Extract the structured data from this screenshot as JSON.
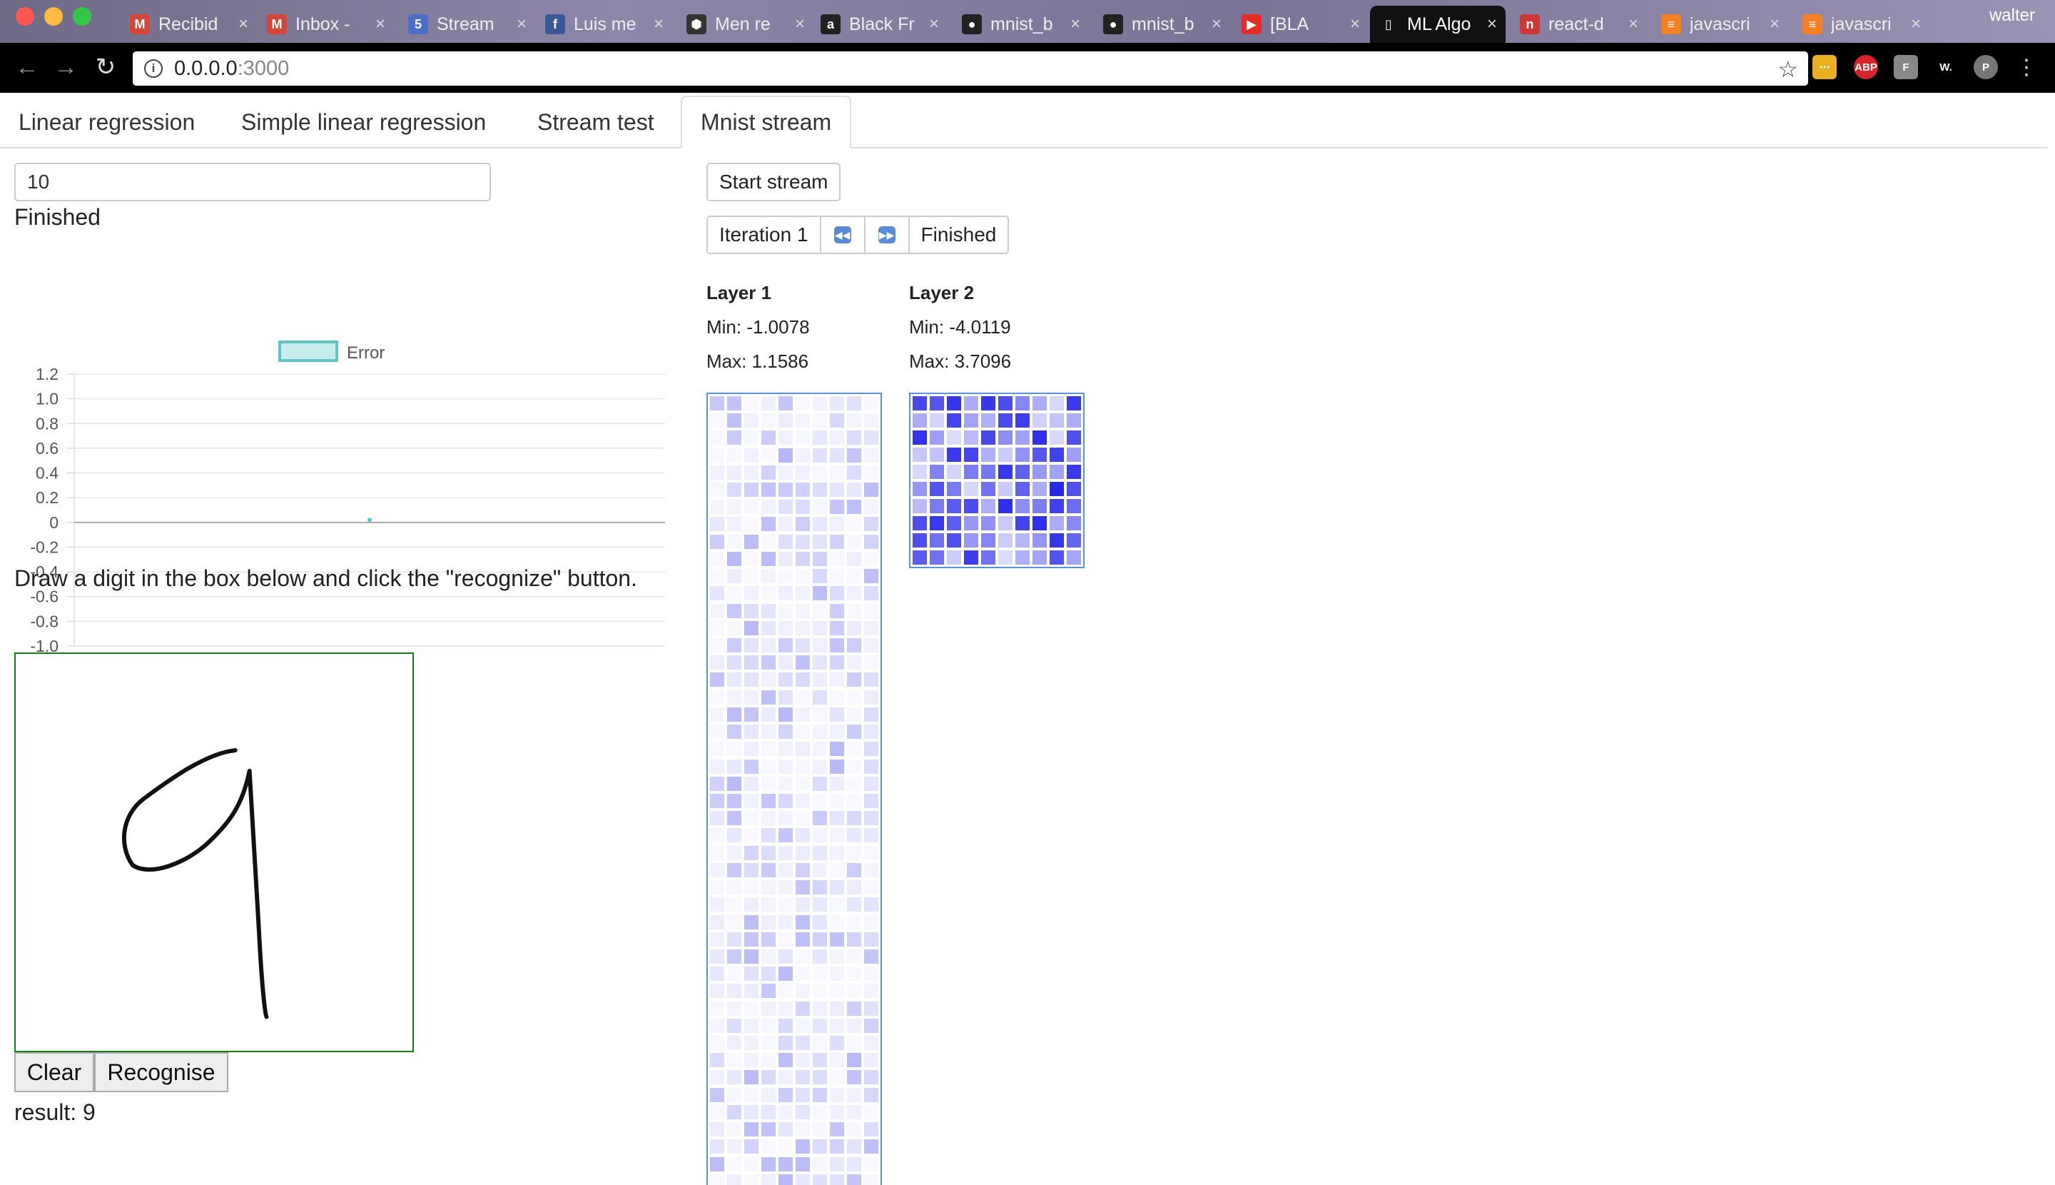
{
  "browser": {
    "tabs": [
      {
        "title": "Recibid",
        "icon": "gmail-icon",
        "color": "#d44638",
        "glyph": "M"
      },
      {
        "title": "Inbox -",
        "icon": "gmail-icon",
        "color": "#d44638",
        "glyph": "M"
      },
      {
        "title": "Stream",
        "icon": "html5-icon",
        "color": "#4b6fc6",
        "glyph": "5"
      },
      {
        "title": "Luis me",
        "icon": "facebook-icon",
        "color": "#3b5998",
        "glyph": "f"
      },
      {
        "title": "Men re",
        "icon": "hexagon-icon",
        "color": "#333333",
        "glyph": "⬢"
      },
      {
        "title": "Black Fr",
        "icon": "amazon-icon",
        "color": "#222222",
        "glyph": "a"
      },
      {
        "title": "mnist_b",
        "icon": "github-icon",
        "color": "#222222",
        "glyph": "●"
      },
      {
        "title": "mnist_b",
        "icon": "github-icon",
        "color": "#222222",
        "glyph": "●"
      },
      {
        "title": "[BLA",
        "icon": "youtube-icon",
        "color": "#e52d27",
        "glyph": "▶"
      },
      {
        "title": "ML Algo",
        "icon": "page-icon",
        "color": "#111111",
        "glyph": "▯",
        "active": true
      },
      {
        "title": "react-d",
        "icon": "npm-icon",
        "color": "#cb3837",
        "glyph": "n"
      },
      {
        "title": "javascri",
        "icon": "stackoverflow-icon",
        "color": "#f48024",
        "glyph": "≡"
      },
      {
        "title": "javascri",
        "icon": "stackoverflow-icon",
        "color": "#f48024",
        "glyph": "≡"
      }
    ],
    "profile": "walter",
    "url_host": "0.0.0.0",
    "url_port": ":3000",
    "extensions": [
      {
        "name": "bookmark-extension-icon",
        "color": "#e8b020",
        "glyph": "⋯"
      },
      {
        "name": "adblock-icon",
        "color": "#d8232a",
        "glyph": "ABP"
      },
      {
        "name": "f-extension-icon",
        "color": "#888888",
        "glyph": "F"
      },
      {
        "name": "w-extension-icon",
        "color": "#000000",
        "glyph": "W."
      },
      {
        "name": "p-extension-icon",
        "color": "#777777",
        "glyph": "P"
      }
    ]
  },
  "nav": {
    "tabs": [
      "Linear regression",
      "Simple linear regression",
      "Stream test",
      "Mnist stream"
    ],
    "active_index": 3
  },
  "left": {
    "input_value": "10",
    "status": "Finished",
    "instructions": "Draw a digit in the box below and click the \"recognize\" button.",
    "clear_label": "Clear",
    "recognise_label": "Recognise",
    "result": "result: 9"
  },
  "chart_data": {
    "type": "line",
    "series": [
      {
        "name": "Error",
        "color": "#5cc6c6",
        "x": [
          1
        ],
        "y": [
          0.02
        ]
      }
    ],
    "ylim": [
      -1.0,
      1.2
    ],
    "yticks": [
      "1.2",
      "1.0",
      "0.8",
      "0.6",
      "0.4",
      "0.2",
      "0",
      "-0.2",
      "-0.4",
      "-0.6",
      "-0.8",
      "-1.0"
    ],
    "grid": true,
    "legend": "top-center"
  },
  "stream": {
    "start_label": "Start stream",
    "iteration_label": "Iteration 1",
    "status": "Finished",
    "layers": [
      {
        "title": "Layer 1",
        "min": "Min: -1.0078",
        "max": "Max: 1.1586"
      },
      {
        "title": "Layer 2",
        "min": "Min: -4.0119",
        "max": "Max: 3.7096"
      }
    ]
  }
}
